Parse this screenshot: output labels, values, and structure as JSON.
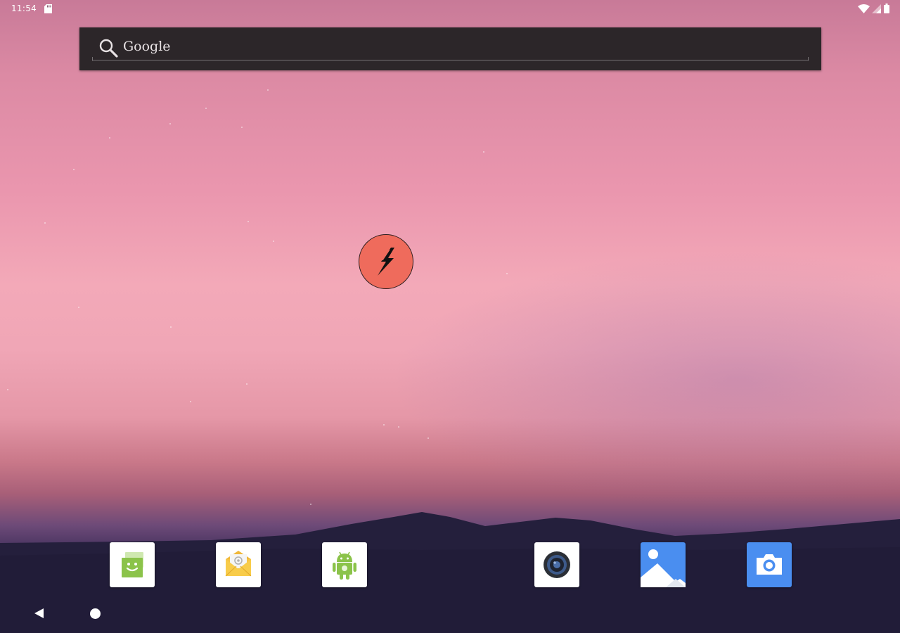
{
  "status_bar": {
    "time": "11:54",
    "icons": [
      "sd-card-icon",
      "wifi-icon",
      "signal-icon",
      "battery-icon"
    ]
  },
  "search_widget": {
    "label": "Google",
    "icon": "search-icon"
  },
  "floating_app": {
    "icon": "lightning-bolt-icon",
    "color": "#ef6b5c"
  },
  "dock": {
    "apps": [
      {
        "icon": "store-icon"
      },
      {
        "icon": "email-icon"
      },
      {
        "icon": "android-icon"
      },
      {
        "icon": "music-icon"
      },
      {
        "icon": "gallery-icon"
      },
      {
        "icon": "camera-icon"
      }
    ]
  },
  "nav_bar": {
    "buttons": [
      "back-icon",
      "home-icon"
    ]
  },
  "colors": {
    "search_bg": "#2c2629",
    "accent_blue": "#4a8ef0",
    "android_green": "#8bc34a",
    "email_yellow": "#f6c343"
  }
}
